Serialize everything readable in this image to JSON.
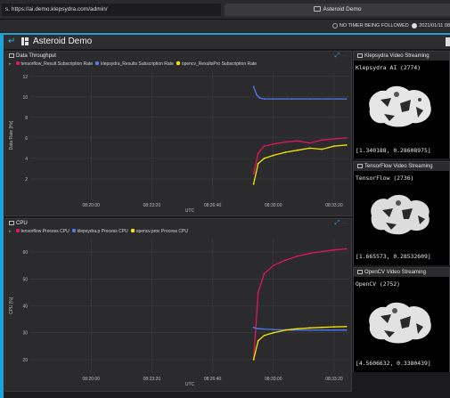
{
  "browser": {
    "url": "s. https://ai.demo.klepsydra.com/admin/",
    "active_tab": "Asteroid Demo"
  },
  "status": {
    "timer": "NO TIMER BEING FOLLOWED",
    "date": "2021/01/11 08"
  },
  "app": {
    "title": "Asteroid Demo"
  },
  "throughput_panel": {
    "title": "Data Throughput",
    "ylabel": "Data Rate [Hz]",
    "xlabel": "UTC",
    "ticks_y": [
      "12",
      "10",
      "8",
      "6",
      "4",
      "2"
    ],
    "ticks_x": [
      "08:20:00",
      "08:23:20",
      "08:26:40",
      "08:30:00",
      "08:33:20"
    ],
    "legend": [
      {
        "label": "tensorflow_Result Subscription Rate",
        "color": "#e0175c"
      },
      {
        "label": "klepsydra_Results Subscription Rate",
        "color": "#4c78f0"
      },
      {
        "label": "opencv_ResultsPro Subscription Rate",
        "color": "#f2e600"
      }
    ]
  },
  "cpu_panel": {
    "title": "CPU",
    "ylabel": "CPU [%]",
    "xlabel": "UTC",
    "ticks_y": [
      "60",
      "50",
      "40",
      "30",
      "20"
    ],
    "ticks_x": [
      "08:20:00",
      "08:23:20",
      "08:26:40",
      "08:30:00",
      "08:33:20"
    ],
    "legend": [
      {
        "label": "tensorflow Process CPU",
        "color": "#e0175c"
      },
      {
        "label": "klepsydra.p Process CPU",
        "color": "#4c78f0"
      },
      {
        "label": "opencv.proc Process CPU",
        "color": "#f2e600"
      }
    ]
  },
  "video_panels": [
    {
      "title": "Klepsydra Video Streaming",
      "name": "Klepsydra AI (2774)",
      "coords": "[1.340188, 0.28608975]"
    },
    {
      "title": "TensorFlow Video Streaming",
      "name": "TensorFlow (2736)",
      "coords": "[1.665573, 0.28532609]"
    },
    {
      "title": "OpenCV Video Streaming",
      "name": "OpenCV (2752)",
      "coords": "[4.5606632, 0.3380439]"
    }
  ],
  "chart_data": [
    {
      "type": "line",
      "title": "Data Throughput",
      "xlabel": "UTC",
      "ylabel": "Data Rate [Hz]",
      "x_ticks": [
        "08:20:00",
        "08:23:20",
        "08:26:40",
        "08:30:00",
        "08:33:20"
      ],
      "ylim": [
        0,
        12.5
      ],
      "grid": true,
      "legend_position": "top-left",
      "series": [
        {
          "name": "tensorflow_Result Subscription Rate",
          "color": "#e0175c",
          "x": [
            "08:28:55",
            "08:29:10",
            "08:29:30",
            "08:30:00",
            "08:30:40",
            "08:31:20",
            "08:32:00",
            "08:32:40",
            "08:33:20",
            "08:34:00"
          ],
          "y": [
            2.5,
            4.5,
            5.2,
            5.4,
            5.6,
            5.7,
            5.5,
            5.8,
            5.9,
            6.0
          ]
        },
        {
          "name": "klepsydra_Results Subscription Rate",
          "color": "#4c78f0",
          "x": [
            "08:28:55",
            "08:29:05",
            "08:29:15",
            "08:29:30",
            "08:30:00",
            "08:31:00",
            "08:32:00",
            "08:33:00",
            "08:34:00"
          ],
          "y": [
            11.0,
            10.2,
            9.9,
            9.8,
            9.8,
            9.8,
            9.8,
            9.8,
            9.8
          ]
        },
        {
          "name": "opencv_ResultsPro Subscription Rate",
          "color": "#f2e600",
          "x": [
            "08:28:55",
            "08:29:10",
            "08:29:30",
            "08:30:00",
            "08:30:40",
            "08:31:20",
            "08:32:00",
            "08:32:40",
            "08:33:20",
            "08:34:00"
          ],
          "y": [
            1.5,
            3.5,
            4.0,
            4.3,
            4.6,
            4.8,
            5.0,
            4.9,
            5.2,
            5.3
          ]
        }
      ]
    },
    {
      "type": "line",
      "title": "CPU",
      "xlabel": "UTC",
      "ylabel": "CPU [%]",
      "x_ticks": [
        "08:20:00",
        "08:23:20",
        "08:26:40",
        "08:30:00",
        "08:33:20"
      ],
      "ylim": [
        15,
        65
      ],
      "grid": true,
      "legend_position": "top-left",
      "series": [
        {
          "name": "tensorflow Process CPU",
          "color": "#e0175c",
          "x": [
            "08:28:55",
            "08:29:10",
            "08:29:30",
            "08:30:00",
            "08:30:40",
            "08:31:20",
            "08:32:00",
            "08:32:40",
            "08:33:20",
            "08:34:00"
          ],
          "y": [
            20,
            45,
            52,
            55,
            57,
            58.5,
            59.5,
            60.2,
            60.8,
            61.2
          ]
        },
        {
          "name": "klepsydra.p Process CPU",
          "color": "#4c78f0",
          "x": [
            "08:28:55",
            "08:29:10",
            "08:30:00",
            "08:31:00",
            "08:32:00",
            "08:33:00",
            "08:34:00"
          ],
          "y": [
            32,
            31.5,
            31.2,
            31.0,
            31.0,
            31.0,
            31.0
          ]
        },
        {
          "name": "opencv.proc Process CPU",
          "color": "#f2e600",
          "x": [
            "08:28:55",
            "08:29:10",
            "08:29:30",
            "08:30:00",
            "08:30:40",
            "08:31:20",
            "08:32:00",
            "08:32:40",
            "08:33:20",
            "08:34:00"
          ],
          "y": [
            20,
            27,
            29,
            30,
            31,
            31.5,
            31.8,
            32,
            32.2,
            32.3
          ]
        }
      ]
    }
  ]
}
